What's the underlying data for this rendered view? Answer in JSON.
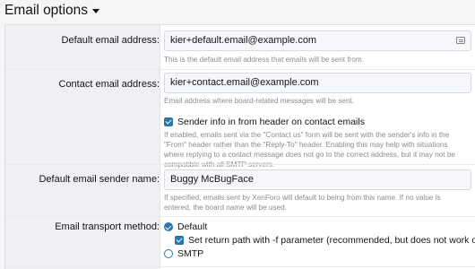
{
  "header": {
    "title": "Email options"
  },
  "fields": {
    "default_email": {
      "label": "Default email address:",
      "value": "kier+default.email@example.com",
      "hint": "This is the default email address that emails will be sent from."
    },
    "contact_email": {
      "label": "Contact email address:",
      "value": "kier+contact.email@example.com",
      "hint": "Email address where board-related messages will be sent."
    },
    "sender_info": {
      "label": "Sender info in from header on contact emails",
      "checked": true,
      "hint": "If enabled, emails sent via the \"Contact us\" form will be sent with the sender's info in the \"From\" header rather than the \"Reply-To\" header. Enabling this may help with situations where replying to a contact message does not go to the correct address, but it may not be compatible with all SMTP servers."
    },
    "sender_name": {
      "label": "Default email sender name:",
      "value": "Buggy McBugFace",
      "hint": "If specified, emails sent by XenForo will default to being from this name. If no value is entered, the board name will be used."
    },
    "transport": {
      "label": "Email transport method:",
      "options": [
        {
          "label": "Default",
          "selected": true
        },
        {
          "label": "SMTP",
          "selected": false
        }
      ],
      "return_path": {
        "label": "Set return path with -f parameter (recommended, but does not work on all servers)",
        "checked": true
      }
    }
  },
  "colors": {
    "accent": "#2577b1",
    "label_column": "#eef0f3"
  },
  "icons": {
    "header_caret": "caret-down-icon",
    "input_addon": "address-card-icon"
  }
}
